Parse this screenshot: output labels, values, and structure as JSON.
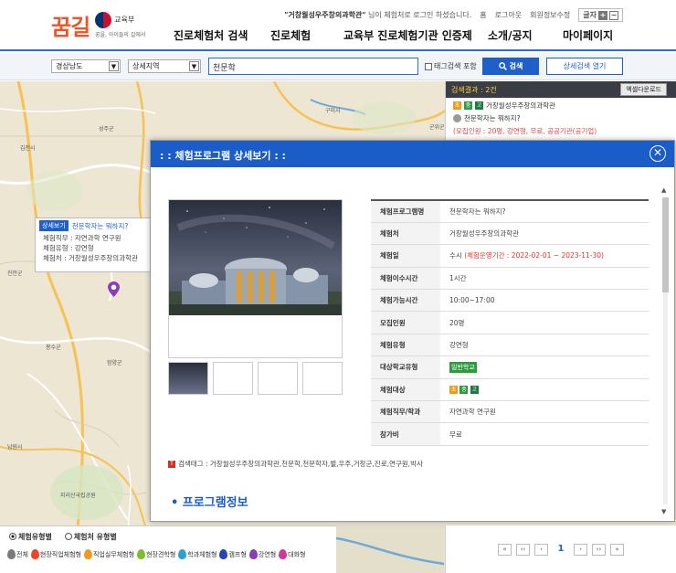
{
  "header": {
    "logo_text": "꿈길",
    "ministry": "교육부",
    "slogan": "꿈을, 아이들의 길에서",
    "welcome_name": "\"거창월성우주창의과학관\"",
    "welcome_rest": " 님이 체험처로 로그인 하셨습니다.",
    "links": [
      "홈",
      "로그아웃",
      "회원정보수정"
    ],
    "font_label": "글자",
    "font_plus": "+",
    "font_minus": "−",
    "menu": [
      "진로체험처 검색",
      "진로체험",
      "교육부 진로체험기관 인증제",
      "소개/공지",
      "마이페이지"
    ]
  },
  "search": {
    "province": "경상남도",
    "region": "상세지역",
    "keyword": "천문학",
    "tag_label": "태그검색 포함",
    "search_label": "검색",
    "detail_label": "상세검색 열기"
  },
  "result": {
    "count": "검색결과 : 2건",
    "excel_label": "엑셀다운로드",
    "badges": [
      "초",
      "중",
      "고"
    ],
    "org": "거창월성우주창의과학관",
    "program": "천문학자는 뭐하지?",
    "meta": "(모집인원 : 20명, 강연형, 무료, 공공기관(공기업)"
  },
  "map": {
    "places": [
      "구미시",
      "군위군",
      "김천시",
      "성주군",
      "칠곡군",
      "진안군",
      "함양군",
      "남원시",
      "봉수군",
      "지리산국립공원",
      "대구",
      "합천"
    ],
    "info_tag": "상세보기",
    "info_title": "천문학자는 뭐하지?",
    "info_lines": [
      "체험직무 : 자연과학 연구원",
      "체험유형 : 강연형",
      "체험처 : 거창월성우주창의과학관"
    ]
  },
  "legend": {
    "radio1": "체험유형별",
    "radio2": "체험처 유형별",
    "items": [
      {
        "label": "전체",
        "color": "#7a7a7a"
      },
      {
        "label": "현장직업체험형",
        "color": "#e8452b"
      },
      {
        "label": "직업실무체험형",
        "color": "#f19a1d"
      },
      {
        "label": "현장견학형",
        "color": "#7cbf2b"
      },
      {
        "label": "학과체험형",
        "color": "#2c9fd6"
      },
      {
        "label": "캠프형",
        "color": "#2545b8"
      },
      {
        "label": "강연형",
        "color": "#8a3fb6"
      },
      {
        "label": "대화형",
        "color": "#d0399a"
      }
    ]
  },
  "pager": {
    "first": "«",
    "prev2": "‹‹",
    "prev": "‹",
    "current": "1",
    "next": "›",
    "next2": "››",
    "last": "»"
  },
  "modal": {
    "title": ": : 체험프로그램 상세보기 : :",
    "close": "✕",
    "rows": [
      {
        "k": "체험프로그램명",
        "v": "천문학자는 뭐하지?"
      },
      {
        "k": "체험처",
        "v": "거창월성우주창의과학관"
      },
      {
        "k": "체험일",
        "v": "수시 ",
        "v2": "(체험운영기간 : 2022-02-01 ~ 2023-11-30)"
      },
      {
        "k": "체험이수시간",
        "v": "1시간"
      },
      {
        "k": "체험가능시간",
        "v": "10:00~17:00"
      },
      {
        "k": "모집인원",
        "v": "20명"
      },
      {
        "k": "체험유형",
        "v": "강연형"
      },
      {
        "k": "대상학교유형",
        "v": "일반학교"
      },
      {
        "k": "체험대상",
        "v": ""
      },
      {
        "k": "체험직무/학과",
        "v": "자연과학 연구원"
      },
      {
        "k": "참가비",
        "v": "무료"
      }
    ],
    "target_badges": [
      "초",
      "중",
      "고"
    ],
    "tags": "검색태그 : 거창월성우주창의과학관,천문학,천문학자,별,우주,거창군,진로,연구원,박사",
    "section": "• 프로그램정보"
  },
  "colors": {
    "accent": "#1a5cc8",
    "logo": "#e8562a",
    "highlight": "#e0322b"
  }
}
